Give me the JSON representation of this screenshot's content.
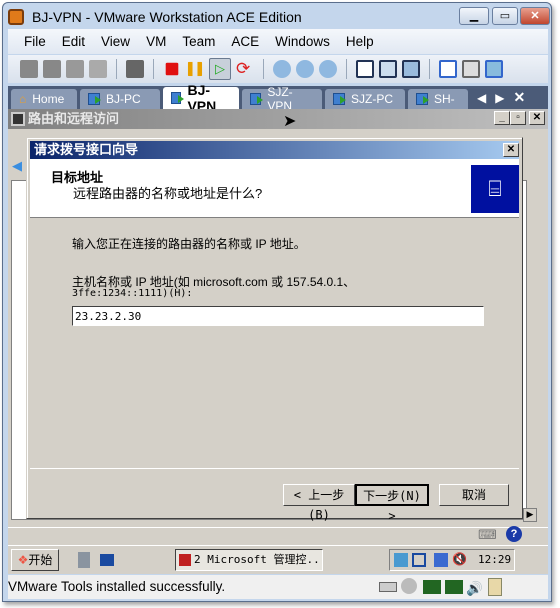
{
  "window": {
    "title": "BJ-VPN - VMware Workstation ACE Edition",
    "controls": [
      "minimize",
      "maximize",
      "close"
    ]
  },
  "menu": [
    "File",
    "Edit",
    "View",
    "VM",
    "Team",
    "ACE",
    "Windows",
    "Help"
  ],
  "toolbar": {
    "icons": [
      "power-off-icon",
      "power-on-icon",
      "snapshot-icon",
      "usb-icon",
      "console-icon",
      "stop-icon",
      "pause-icon",
      "play-icon",
      "reset-icon",
      "take-snapshot-icon",
      "revert-snapshot-icon",
      "snapshot-manager-icon",
      "sidebar-view-icon",
      "fullscreen-icon",
      "quick-switch-icon",
      "preferences-icon",
      "summary-icon",
      "console-view-icon"
    ]
  },
  "tabs": [
    {
      "label": "Home"
    },
    {
      "label": "BJ-PC"
    },
    {
      "label": "BJ-VPN",
      "active": true
    },
    {
      "label": "SJZ-VPN"
    },
    {
      "label": "SJZ-PC"
    },
    {
      "label": "SH-"
    }
  ],
  "mmc": {
    "title": "路由和远程访问"
  },
  "dialog": {
    "title": "请求拨号接口向导",
    "heading": "目标地址",
    "subheading": "远程路由器的名称或地址是什么?",
    "instruction": "输入您正在连接的路由器的名称或 IP 地址。",
    "field_label_line1": "主机名称或 IP 地址(如 microsoft.com 或 157.54.0.1、",
    "field_label_line2": "3ffe:1234::1111)(H):",
    "field_value": "23.23.2.30",
    "back": "< 上一步(B)",
    "next": "下一步(N) >",
    "cancel": "取消"
  },
  "taskbar": {
    "start": "开始",
    "task": "2 Microsoft 管理控...",
    "clock": "12:29"
  },
  "status": {
    "text": "VMware Tools installed successfully."
  }
}
